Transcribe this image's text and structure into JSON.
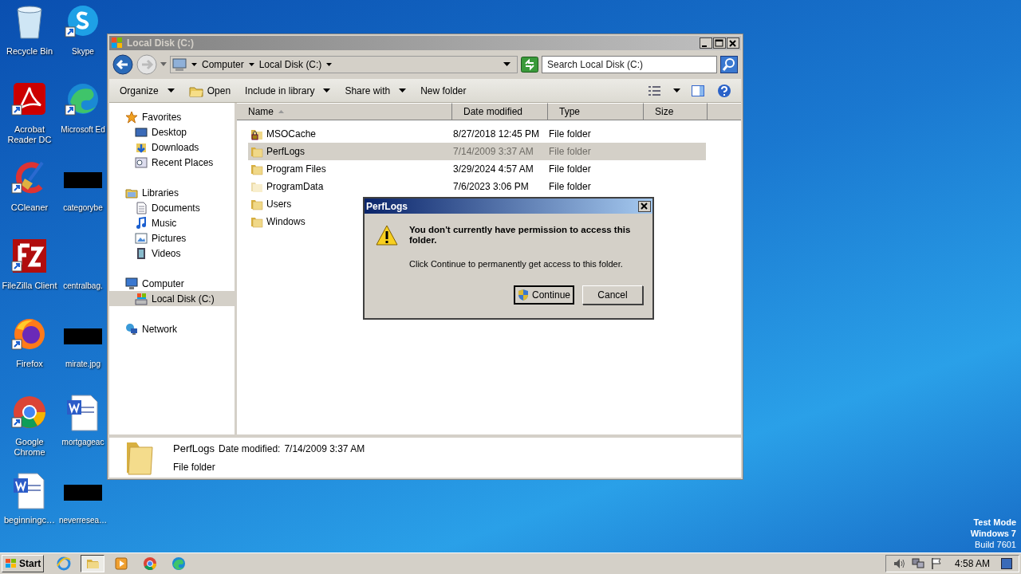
{
  "desktop_icons": [
    {
      "label": "Recycle Bin",
      "kind": "recycle",
      "shortcut": false
    },
    {
      "label": "Skype",
      "kind": "skype",
      "shortcut": true
    },
    {
      "label": "Acrobat Reader DC",
      "kind": "acrobat",
      "shortcut": true
    },
    {
      "label": "Microsoft Ed",
      "kind": "edge",
      "shortcut": true
    },
    {
      "label": "CCleaner",
      "kind": "ccleaner",
      "shortcut": true
    },
    {
      "label": "categorybe",
      "kind": "blank",
      "shortcut": false
    },
    {
      "label": "FileZilla Client",
      "kind": "filezilla",
      "shortcut": true
    },
    {
      "label": "centralbag.",
      "kind": "none"
    },
    {
      "label": "Firefox",
      "kind": "firefox",
      "shortcut": true
    },
    {
      "label": "mirate.jpg",
      "kind": "blank",
      "shortcut": false
    },
    {
      "label": "Google Chrome",
      "kind": "chrome",
      "shortcut": true
    },
    {
      "label": "mortgageac",
      "kind": "word",
      "shortcut": false
    },
    {
      "label": "beginningc…",
      "kind": "word",
      "shortcut": false
    },
    {
      "label": "neverresea…",
      "kind": "blank",
      "shortcut": false
    }
  ],
  "window": {
    "title": "Local Disk (C:)",
    "active": false
  },
  "address_bar": {
    "crumbs": [
      "Computer",
      "Local Disk (C:)"
    ]
  },
  "search": {
    "placeholder": "Search Local Disk (C:)"
  },
  "toolbar": [
    {
      "label": "Organize",
      "kind": "menu"
    },
    {
      "label": "Open",
      "kind": "open"
    },
    {
      "label": "Include in library",
      "kind": "menu"
    },
    {
      "label": "Share with",
      "kind": "menu"
    },
    {
      "label": "New folder",
      "kind": "plain"
    }
  ],
  "nav": [
    {
      "label": "Favorites",
      "kind": "star",
      "selected": false,
      "children": [
        {
          "label": "Desktop",
          "kind": "desktop",
          "selected": false
        },
        {
          "label": "Downloads",
          "kind": "downloads",
          "selected": false
        },
        {
          "label": "Recent Places",
          "kind": "recent",
          "selected": false
        }
      ]
    },
    {
      "label": "Libraries",
      "kind": "libraries",
      "selected": false,
      "children": [
        {
          "label": "Documents",
          "kind": "documents",
          "selected": false
        },
        {
          "label": "Music",
          "kind": "music",
          "selected": false
        },
        {
          "label": "Pictures",
          "kind": "pictures",
          "selected": false
        },
        {
          "label": "Videos",
          "kind": "videos",
          "selected": false
        }
      ]
    },
    {
      "label": "Computer",
      "kind": "computer",
      "selected": false,
      "children": [
        {
          "label": "Local Disk (C:)",
          "kind": "drive",
          "selected": true
        }
      ]
    },
    {
      "label": "Network",
      "kind": "network",
      "selected": false
    }
  ],
  "columns": [
    {
      "label": "Name",
      "sorted": true
    },
    {
      "label": "Date modified",
      "sorted": false
    },
    {
      "label": "Type",
      "sorted": false
    },
    {
      "label": "Size",
      "sorted": false
    }
  ],
  "files": [
    {
      "name": "MSOCache",
      "date": "8/27/2018 12:45 PM",
      "type": "File folder",
      "kind": "locked",
      "selected": false
    },
    {
      "name": "PerfLogs",
      "date": "7/14/2009 3:37 AM",
      "type": "File folder",
      "kind": "folder",
      "selected": true
    },
    {
      "name": "Program Files",
      "date": "3/29/2024 4:57 AM",
      "type": "File folder",
      "kind": "folder",
      "selected": false
    },
    {
      "name": "ProgramData",
      "date": "7/6/2023 3:06 PM",
      "type": "File folder",
      "kind": "hidden",
      "selected": false
    },
    {
      "name": "Users",
      "kind": "folder",
      "selected": false
    },
    {
      "name": "Windows",
      "kind": "folder",
      "selected": false
    }
  ],
  "details_pane": {
    "name": "PerfLogs",
    "date_label": "Date modified:",
    "date": "7/14/2009 3:37 AM",
    "type": "File folder"
  },
  "dialog": {
    "title": "PerfLogs",
    "message": "You don't currently have permission to access this folder.",
    "hint": "Click Continue to permanently get access to this folder.",
    "buttons": [
      {
        "label": "Continue",
        "default": true,
        "shield": true
      },
      {
        "label": "Cancel",
        "default": false,
        "shield": false
      }
    ]
  },
  "os_notice": [
    "Test Mode",
    "Windows 7",
    "Build 7601"
  ],
  "taskbar": {
    "start": "Start",
    "apps": [
      {
        "kind": "ie",
        "active": false
      },
      {
        "kind": "explorer",
        "active": true
      },
      {
        "kind": "media",
        "active": false
      },
      {
        "kind": "chrome",
        "active": false
      },
      {
        "kind": "edge",
        "active": false
      }
    ],
    "clock": "4:58 AM"
  }
}
